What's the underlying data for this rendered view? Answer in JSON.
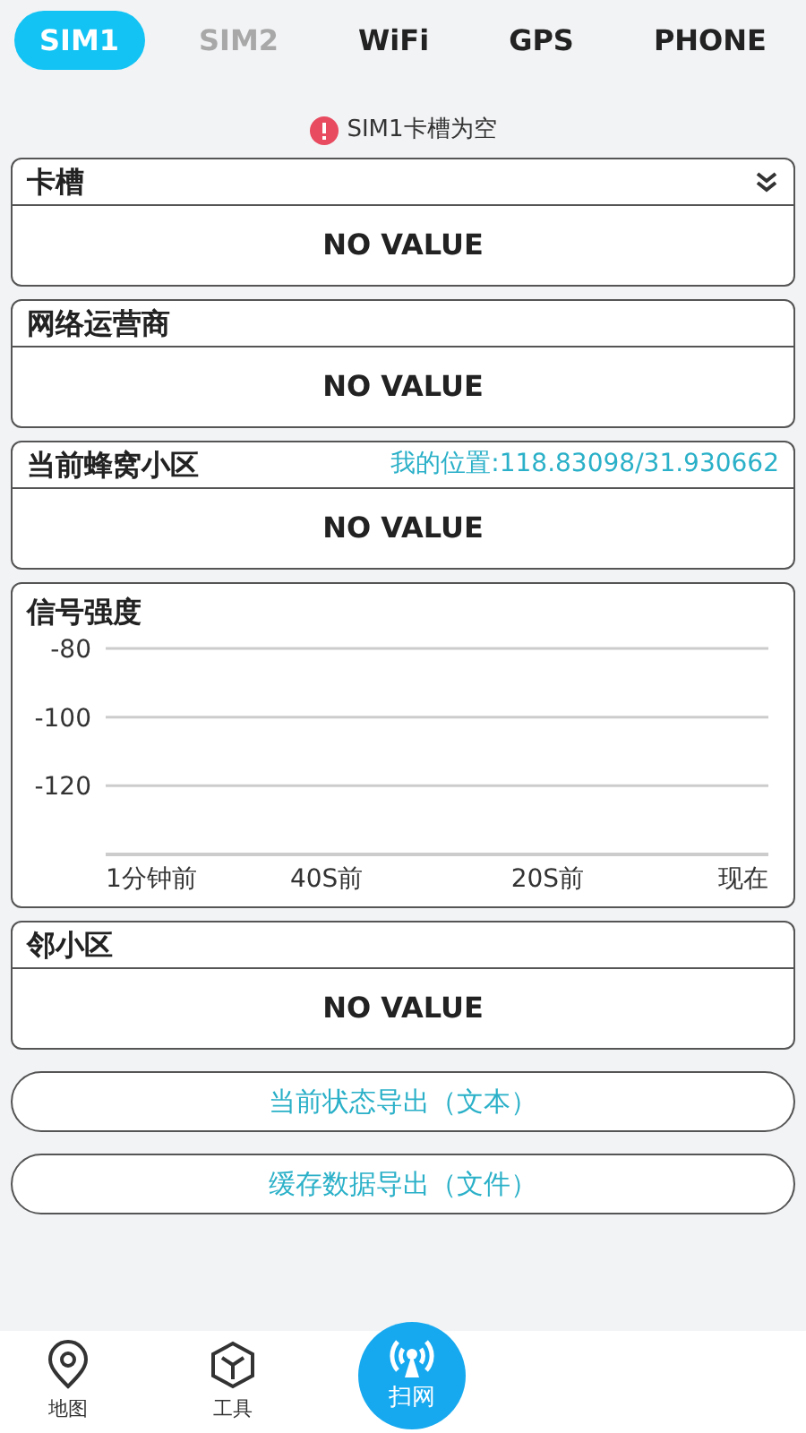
{
  "tabs": [
    {
      "label": "SIM1",
      "selected": true,
      "disabled": false
    },
    {
      "label": "SIM2",
      "selected": false,
      "disabled": true
    },
    {
      "label": "WiFi",
      "selected": false,
      "disabled": false
    },
    {
      "label": "GPS",
      "selected": false,
      "disabled": false
    },
    {
      "label": "PHONE",
      "selected": false,
      "disabled": false
    }
  ],
  "notice": "SIM1卡槽为空",
  "cards_top": [
    {
      "title": "卡槽",
      "value": "NO VALUE",
      "collapsible": true
    },
    {
      "title": "网络运营商",
      "value": "NO VALUE"
    },
    {
      "title": "当前蜂窝小区",
      "value": "NO VALUE",
      "location": "我的位置:118.83098/31.930662"
    }
  ],
  "signal": {
    "title": "信号强度",
    "chart_data": {
      "type": "line",
      "categories": [
        "1分钟前",
        "40S前",
        "20S前",
        "现在"
      ],
      "ylim": [
        -140,
        -80
      ],
      "yticks": [
        -80,
        -100,
        -120
      ]
    }
  },
  "neighbor": {
    "title": "邻小区",
    "value": "NO VALUE"
  },
  "actions": [
    "当前状态导出（文本）",
    "缓存数据导出（文件）"
  ],
  "nav": [
    {
      "label": "地图",
      "kind": "map",
      "selected": false
    },
    {
      "label": "工具",
      "kind": "tools",
      "selected": false
    },
    {
      "label": "扫网",
      "kind": "scan",
      "selected": true
    }
  ]
}
